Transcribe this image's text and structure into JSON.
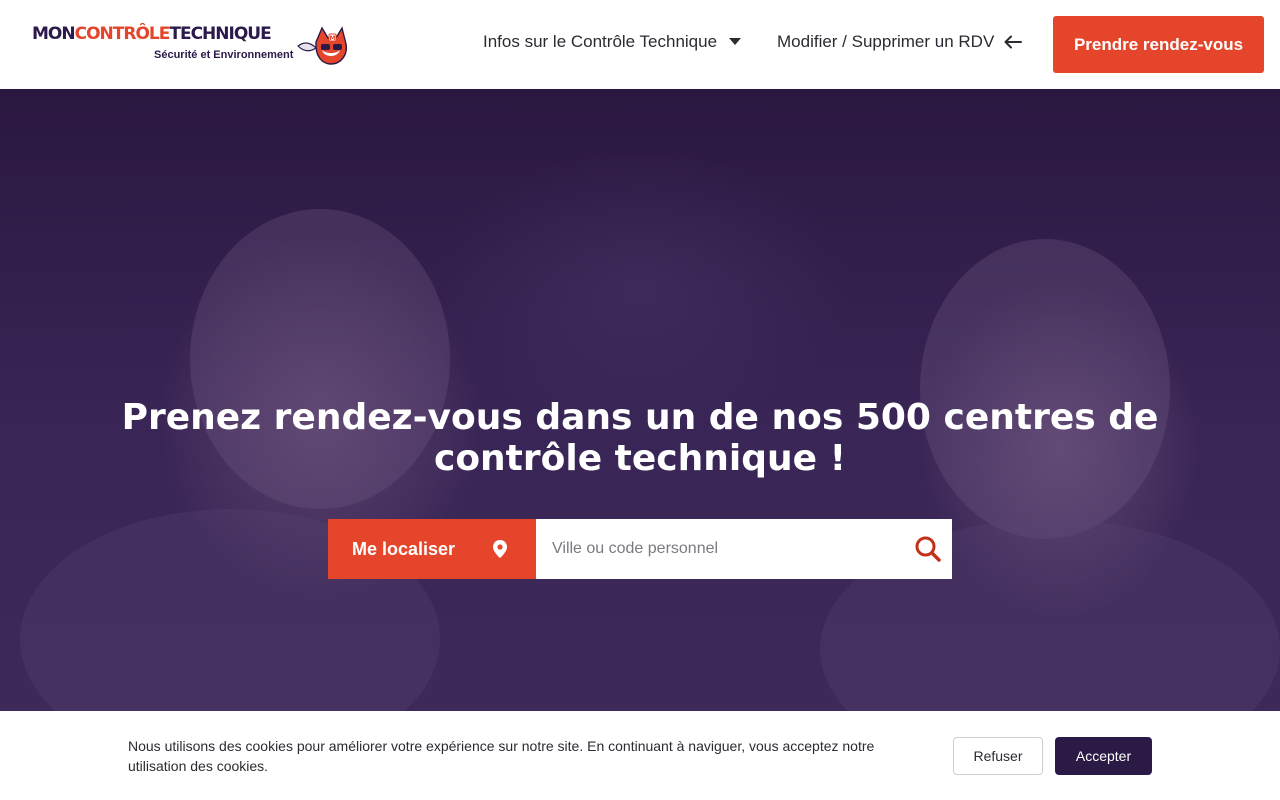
{
  "header": {
    "logo": {
      "part_mon": "MON",
      "part_controle": "CONTRÔLE",
      "part_technique": "TECHNIQUE",
      "tagline": "Sécurité et Environnement",
      "mascot_icon": "fox-mascot-icon"
    },
    "nav": {
      "infos_label": "Infos sur le Contrôle Technique",
      "infos_icon": "caret-down-icon",
      "modify_label": "Modifier / Supprimer un RDV",
      "modify_icon": "arrow-left-icon"
    },
    "cta_label": "Prendre rendez-vous"
  },
  "hero": {
    "title": "Prenez rendez-vous dans un de nos 500 centres de contrôle technique !",
    "locate_label": "Me localiser",
    "locate_icon": "map-pin-icon",
    "search_placeholder": "Ville ou code personnel",
    "search_icon": "search-icon"
  },
  "cookie": {
    "text": "Nous utilisons des cookies pour améliorer votre expérience sur notre site. En continuant à naviguer, vous acceptez notre utilisation des cookies.",
    "refuse_label": "Refuser",
    "accept_label": "Accepter"
  },
  "colors": {
    "accent": "#e5452a",
    "brand_dark": "#2b1a45",
    "hero_overlay": "#2e1a45"
  }
}
